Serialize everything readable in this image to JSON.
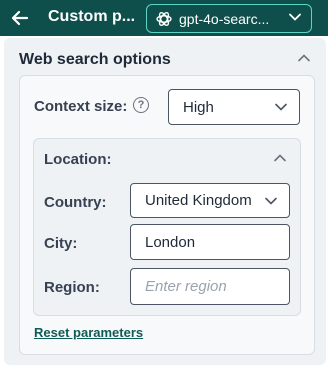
{
  "header": {
    "title": "Custom p...",
    "model_value": "gpt-4o-searc..."
  },
  "panel": {
    "title": "Web search options",
    "context_size": {
      "label": "Context size:",
      "value": "High"
    },
    "location": {
      "title": "Location:",
      "country": {
        "label": "Country:",
        "value": "United Kingdom"
      },
      "city": {
        "label": "City:",
        "value": "London"
      },
      "region": {
        "label": "Region:",
        "placeholder": "Enter region"
      }
    },
    "reset_label": "Reset parameters"
  },
  "colors": {
    "header_bg": "#0f4f4b",
    "accent_border": "#5bd6c6",
    "link": "#0f5c57"
  },
  "icons": [
    "back-arrow-icon",
    "openai-logo-icon",
    "chevron-down-icon",
    "chevron-up-icon",
    "help-icon"
  ]
}
